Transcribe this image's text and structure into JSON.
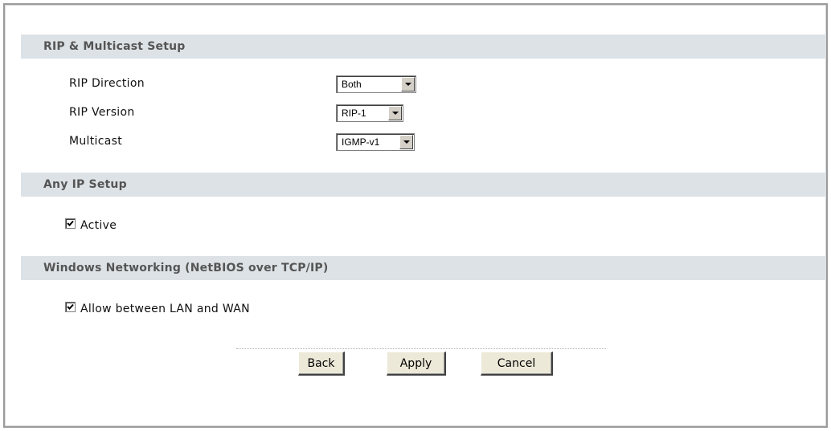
{
  "sections": {
    "rip": {
      "title": "RIP & Multicast Setup",
      "rip_direction": {
        "label": "RIP Direction",
        "value": "Both"
      },
      "rip_version": {
        "label": "RIP Version",
        "value": "RIP-1"
      },
      "multicast": {
        "label": "Multicast",
        "value": "IGMP-v1"
      }
    },
    "anyip": {
      "title": "Any IP Setup",
      "active": {
        "label": "Active",
        "checked": true
      }
    },
    "netbios": {
      "title": "Windows Networking (NetBIOS over TCP/IP)",
      "allow": {
        "label": "Allow between LAN and WAN",
        "checked": true
      }
    }
  },
  "buttons": {
    "back": "Back",
    "apply": "Apply",
    "cancel": "Cancel"
  },
  "colors": {
    "header_bg": "#dde2e6",
    "header_text": "#555555",
    "button_bg": "#ece9d8"
  }
}
